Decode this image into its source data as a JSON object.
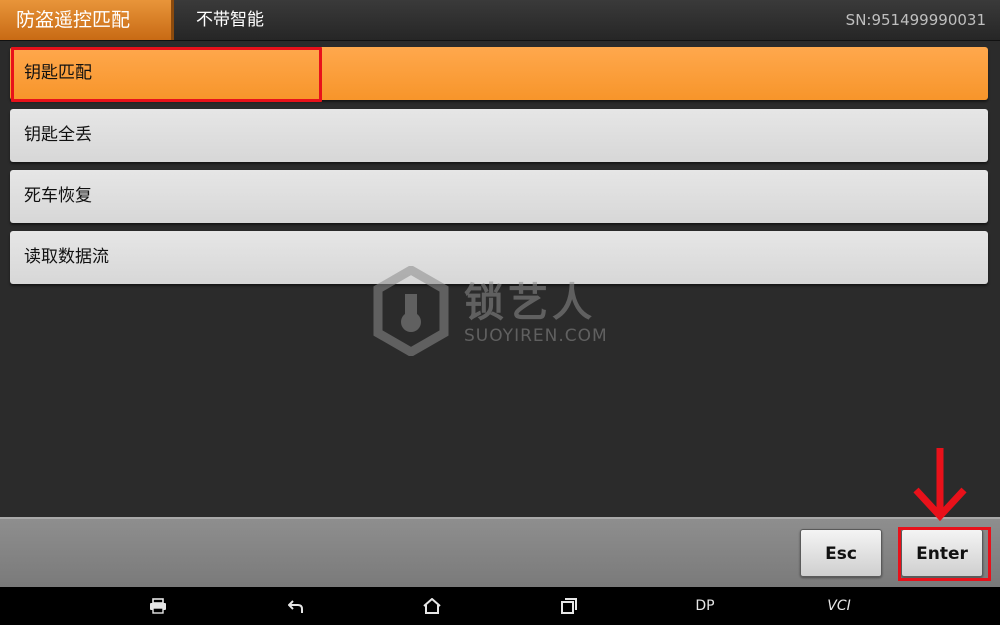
{
  "header": {
    "title": "防盗遥控匹配",
    "subtitle": "不带智能",
    "serial": "SN:951499990031"
  },
  "menu": {
    "items": [
      {
        "label": "钥匙匹配",
        "selected": true
      },
      {
        "label": "钥匙全丢",
        "selected": false
      },
      {
        "label": "死车恢复",
        "selected": false
      },
      {
        "label": "读取数据流",
        "selected": false
      }
    ]
  },
  "watermark": {
    "cn": "锁艺人",
    "en": "SUOYIREN.COM"
  },
  "toolbar": {
    "esc_label": "Esc",
    "enter_label": "Enter"
  },
  "navbar": {
    "dp_label": "DP",
    "vci_label": "VCI"
  },
  "colors": {
    "accent": "#f7952a",
    "highlight_red": "#e8111a"
  }
}
